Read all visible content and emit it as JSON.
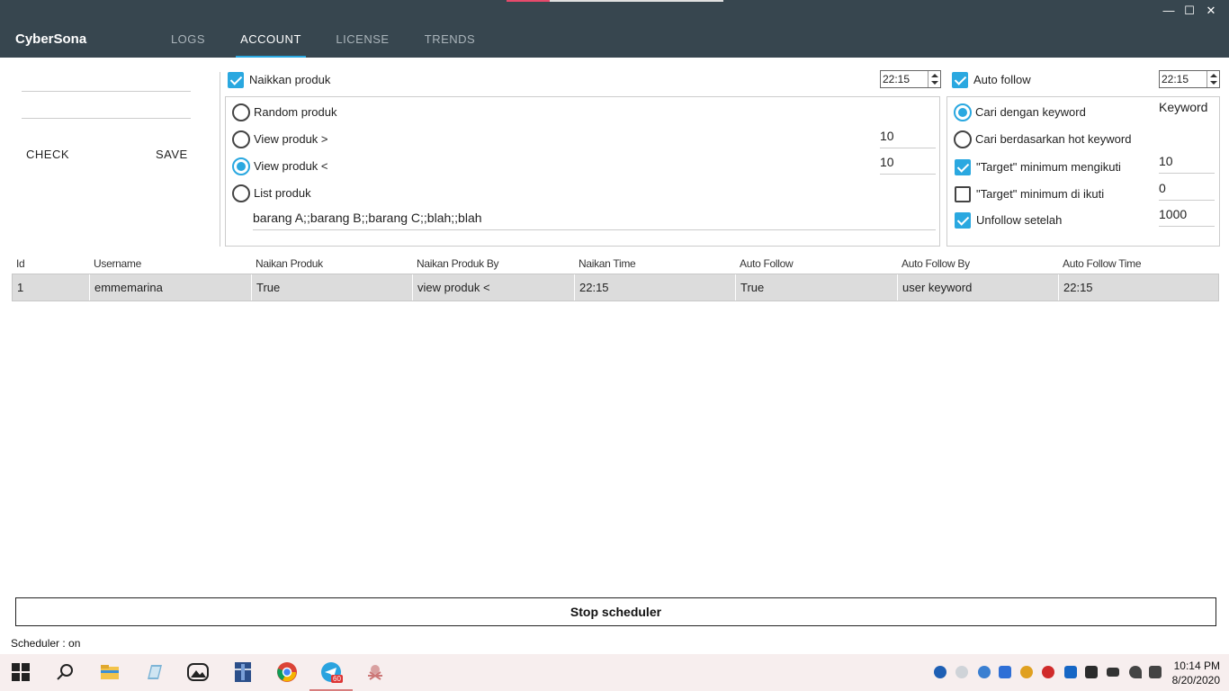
{
  "app": {
    "title": "CyberSona"
  },
  "window": {
    "minimize": "—",
    "maximize": "☐",
    "close": "✕"
  },
  "tabs": [
    {
      "label": "LOGS"
    },
    {
      "label": "ACCOUNT"
    },
    {
      "label": "LICENSE"
    },
    {
      "label": "TRENDS"
    }
  ],
  "account": {
    "check_label": "CHECK",
    "save_label": "SAVE"
  },
  "naikkan": {
    "label": "Naikkan produk",
    "checked": true,
    "time": "22:15",
    "options": [
      {
        "label": "Random produk",
        "selected": false
      },
      {
        "label": "View produk >",
        "selected": false,
        "value": "10"
      },
      {
        "label": "View produk <",
        "selected": true,
        "value": "10"
      },
      {
        "label": "List produk",
        "selected": false
      }
    ],
    "list_value": "barang A;;barang B;;barang C;;blah;;blah"
  },
  "autofollow": {
    "label": "Auto follow",
    "checked": true,
    "time": "22:15",
    "keyword_option": "Cari dengan keyword",
    "keyword_value": "Keyword",
    "hot_option": "Cari berdasarkan hot keyword",
    "min_following_label": "\"Target\" minimum mengikuti",
    "min_following_value": "10",
    "min_followed_label": "\"Target\" minimum di ikuti",
    "min_followed_value": "0",
    "unfollow_label": "Unfollow setelah",
    "unfollow_value": "1000"
  },
  "table": {
    "headers": [
      "Id",
      "Username",
      "Naikan Produk",
      "Naikan Produk By",
      "Naikan Time",
      "Auto Follow",
      "Auto Follow By",
      "Auto Follow Time"
    ],
    "rows": [
      [
        "1",
        "emmemarina",
        "True",
        "view produk <",
        "22:15",
        "True",
        "user keyword",
        "22:15"
      ]
    ]
  },
  "scheduler": {
    "button_label": "Stop scheduler",
    "status": "Scheduler : on"
  },
  "taskbar": {
    "time": "10:14 PM",
    "date": "8/20/2020",
    "telegram_badge": "60",
    "icons": [
      "windows-start-icon",
      "search-icon",
      "file-explorer-icon",
      "notepad-icon",
      "photos-app-icon",
      "archive-icon",
      "chrome-icon",
      "telegram-icon",
      "bug-app-icon"
    ]
  },
  "colors": {
    "accent": "#2aa8e0",
    "appbar": "#37464f",
    "row_bg": "#dcdcdc"
  }
}
